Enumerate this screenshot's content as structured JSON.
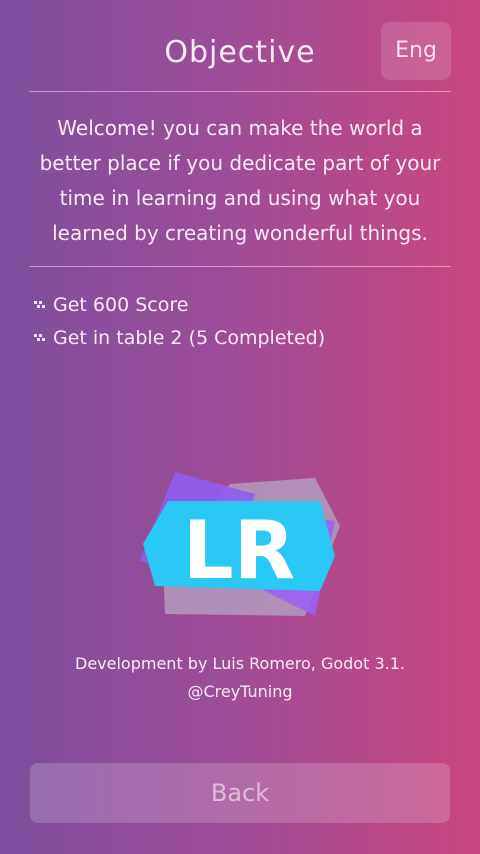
{
  "header": {
    "title": "Objective",
    "language_button": "Eng"
  },
  "description": "Welcome! you can make the world a better place if you dedicate part of your time in learning and using what you learned by creating wonderful things.",
  "objectives": [
    "Get 600 Score",
    "Get in table 2 (5 Completed)"
  ],
  "logo": {
    "text": "LR",
    "colors": {
      "badge": "#29c8f5",
      "text": "#ffffff",
      "purple": "#8f5ef0",
      "grey": "#b39bbd"
    }
  },
  "footer": {
    "credit_line1": "Development by Luis Romero, Godot 3.1.",
    "credit_line2": "@CreyTuning"
  },
  "back_button": "Back"
}
